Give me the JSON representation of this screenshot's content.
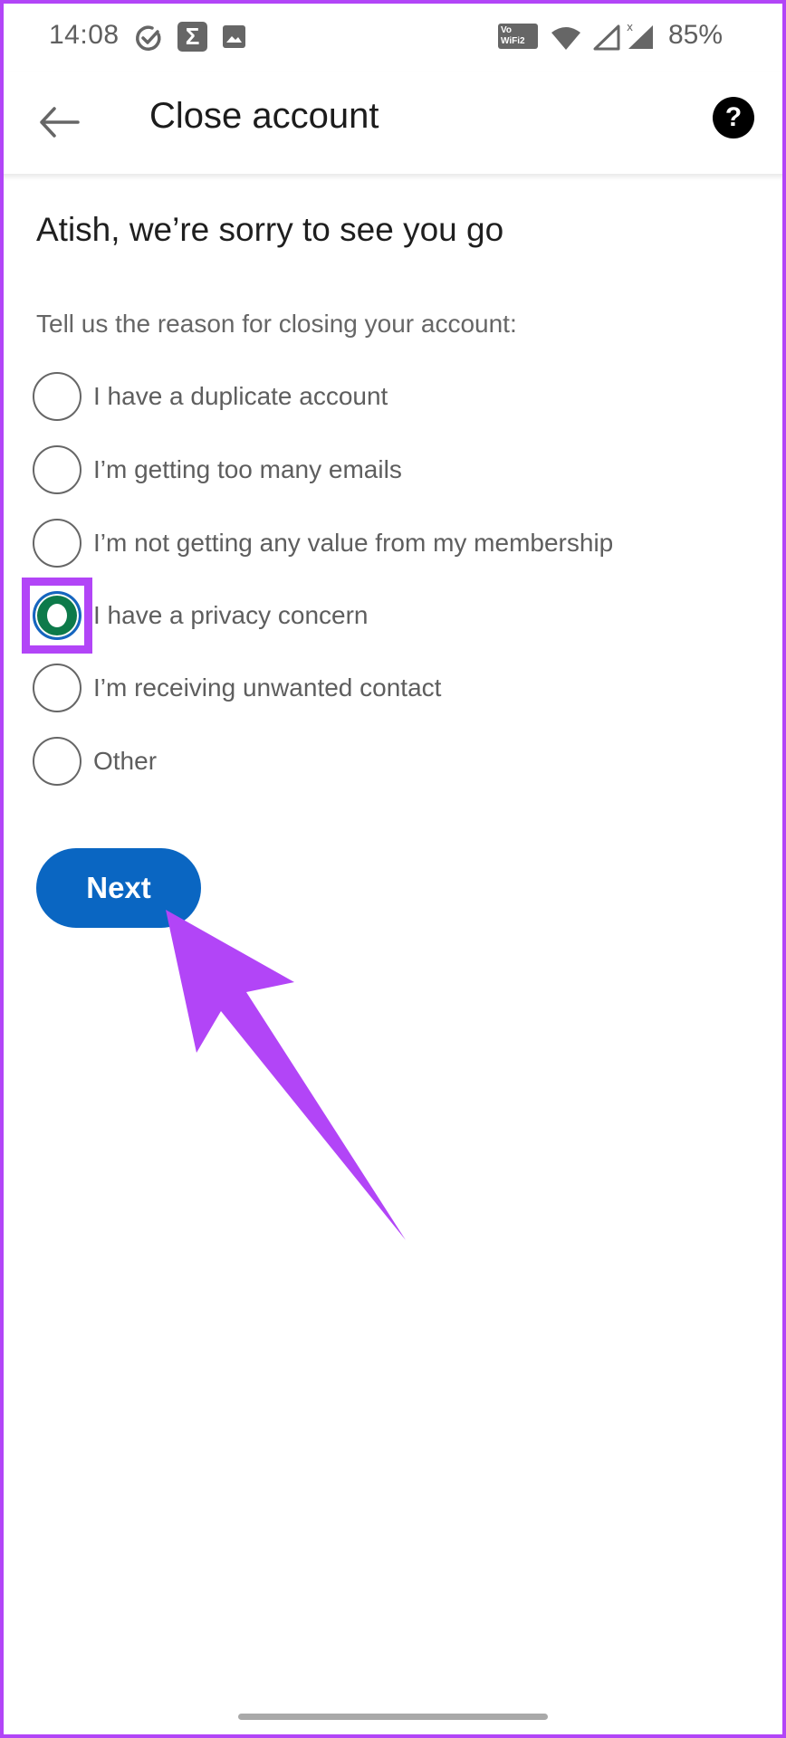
{
  "status_bar": {
    "time": "14:08",
    "left_icons": [
      "task-check-icon",
      "sigma-app-icon",
      "gallery-image-icon"
    ],
    "vowifi_label_top": "Vo",
    "vowifi_label_bottom": "WiFi2",
    "right_icons": [
      "vowifi-icon",
      "wifi-icon",
      "cell-signal-empty-icon",
      "cell-signal-no-service-icon"
    ],
    "no_service_mark": "x",
    "battery": "85%"
  },
  "app_bar": {
    "back_icon": "back-arrow-icon",
    "title": "Close account",
    "help_icon": "help-icon",
    "help_glyph": "?"
  },
  "content": {
    "heading": "Atish, we’re sorry to see you go",
    "subtitle": "Tell us the reason for closing your account:",
    "reasons": [
      {
        "label": "I have a duplicate account",
        "selected": false
      },
      {
        "label": "I’m getting too many emails",
        "selected": false
      },
      {
        "label": "I’m not getting any value from my membership",
        "selected": false
      },
      {
        "label": "I have a privacy concern",
        "selected": true
      },
      {
        "label": "I’m receiving unwanted contact",
        "selected": false
      },
      {
        "label": "Other",
        "selected": false
      }
    ],
    "next_label": "Next"
  },
  "colors": {
    "annotation": "#b245f7",
    "primary_button": "#0a66c2",
    "selected_radio_fill": "#0d7a4a"
  },
  "annotations": {
    "highlight_target": "I have a privacy concern",
    "arrow_target": "Next"
  }
}
